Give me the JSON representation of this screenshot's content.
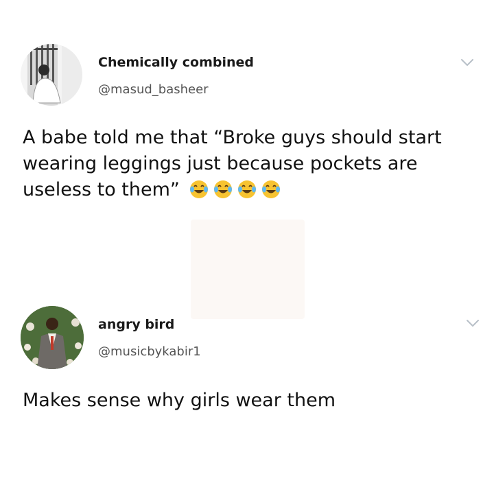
{
  "tweets": [
    {
      "display_name": "Chemically combined",
      "handle": "@masud_basheer",
      "text": "A babe  told me that “Broke guys should start wearing leggings just because pockets are useless to them”",
      "emojis": [
        "face-with-tears-of-joy-icon",
        "face-with-tears-of-joy-icon",
        "face-with-tears-of-joy-icon",
        "face-with-tears-of-joy-icon"
      ]
    },
    {
      "display_name": "angry bird",
      "handle": "@musicbykabir1",
      "text": "Makes sense why girls wear them"
    }
  ],
  "colors": {
    "background": "#ffffff",
    "text": "#111111",
    "handle": "#555555",
    "chevron": "#b8c0c8",
    "emoji_face": "#f7c331"
  }
}
